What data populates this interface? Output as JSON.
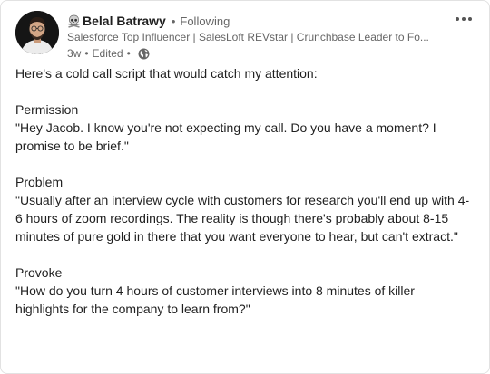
{
  "author": {
    "name": "Belal Batrawy",
    "badge_icon": "skull-icon",
    "follow_status": "Following",
    "headline": "Salesforce Top Influencer | SalesLoft REVstar | Crunchbase Leader to Fo...",
    "time": "3w",
    "edited": "Edited",
    "visibility_icon": "globe-icon"
  },
  "menu": {
    "icon": "more-icon"
  },
  "post": {
    "paragraphs": [
      "Here's a cold call script that would catch my attention:",
      "Permission\n\"Hey Jacob. I know you're not expecting my call. Do you have a moment? I promise to be brief.\"",
      "Problem\n\"Usually after an interview cycle with customers for research you'll end up with 4-6 hours of zoom recordings. The reality is though there's probably about 8-15 minutes of pure gold in there that you want everyone to hear, but can't extract.\"",
      "Provoke\n\"How do you turn 4 hours of customer interviews into 8 minutes of killer highlights for the company to learn from?\""
    ]
  },
  "colors": {
    "text_primary": "#1f1f1f",
    "text_secondary": "#666666",
    "border": "#e2e2e2"
  }
}
